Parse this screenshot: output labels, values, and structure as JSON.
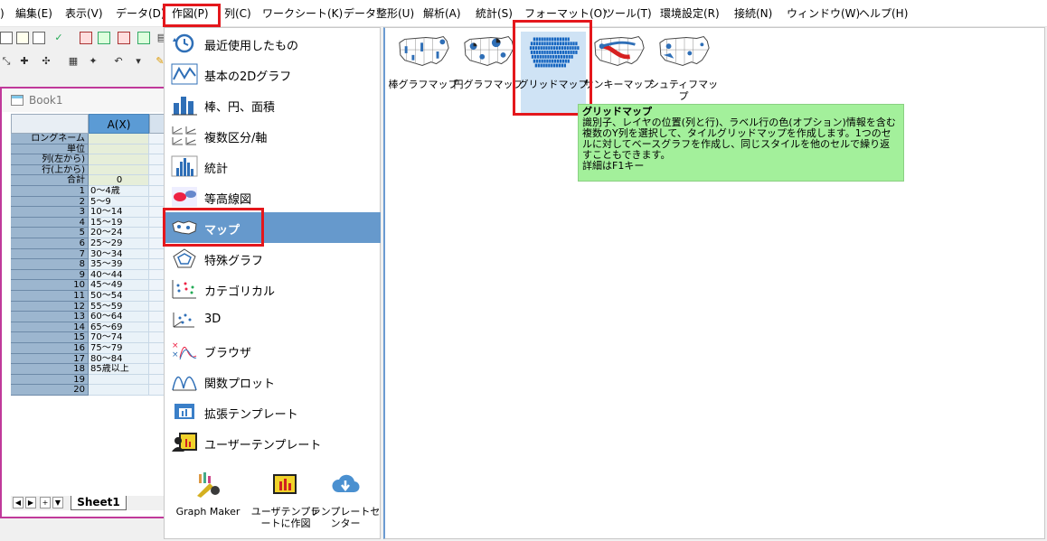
{
  "menu": {
    "edit": "編集(E)",
    "view": "表示(V)",
    "data": "データ(D)",
    "plot": "作図(P)",
    "column": "列(C)",
    "worksheet": "ワークシート(K)",
    "data_shape": "データ整形(U)",
    "analysis": "解析(A)",
    "statistics": "統計(S)",
    "format": "フォーマット(O)",
    "tools": "ツール(T)",
    "preferences": "環境設定(R)",
    "connect": "接続(N)",
    "window": "ウィンドウ(W)",
    "help": "ヘルプ(H)"
  },
  "workbook": {
    "title": "Book1",
    "column_a": "A(X)",
    "meta_rows": [
      "ロングネーム",
      "単位",
      "列(左から)",
      "行(上から)",
      "合計"
    ],
    "sum_value": "0",
    "rows": [
      {
        "n": "1",
        "v": "0〜4歳"
      },
      {
        "n": "2",
        "v": "5〜9"
      },
      {
        "n": "3",
        "v": "10〜14"
      },
      {
        "n": "4",
        "v": "15〜19"
      },
      {
        "n": "5",
        "v": "20〜24"
      },
      {
        "n": "6",
        "v": "25〜29"
      },
      {
        "n": "7",
        "v": "30〜34"
      },
      {
        "n": "8",
        "v": "35〜39"
      },
      {
        "n": "9",
        "v": "40〜44"
      },
      {
        "n": "10",
        "v": "45〜49"
      },
      {
        "n": "11",
        "v": "50〜54"
      },
      {
        "n": "12",
        "v": "55〜59"
      },
      {
        "n": "13",
        "v": "60〜64"
      },
      {
        "n": "14",
        "v": "65〜69"
      },
      {
        "n": "15",
        "v": "70〜74"
      },
      {
        "n": "16",
        "v": "75〜79"
      },
      {
        "n": "17",
        "v": "80〜84"
      },
      {
        "n": "18",
        "v": "85歳以上"
      },
      {
        "n": "19",
        "v": ""
      },
      {
        "n": "20",
        "v": ""
      }
    ],
    "sheet_tab": "Sheet1"
  },
  "dropdown": {
    "items": [
      {
        "label": "最近使用したもの",
        "icon": "clock-icon"
      },
      {
        "label": "基本の2Dグラフ",
        "icon": "line-graph-icon"
      },
      {
        "label": "棒、円、面積",
        "icon": "bar-chart-icon"
      },
      {
        "label": "複数区分/軸",
        "icon": "multi-panel-icon"
      },
      {
        "label": "統計",
        "icon": "histogram-icon"
      },
      {
        "label": "等高線図",
        "icon": "contour-icon"
      },
      {
        "label": "マップ",
        "icon": "map-icon"
      },
      {
        "label": "特殊グラフ",
        "icon": "radar-icon"
      },
      {
        "label": "カテゴリカル",
        "icon": "categorical-icon"
      },
      {
        "label": "3D",
        "icon": "3d-scatter-icon"
      },
      {
        "label": "ブラウザ",
        "icon": "browser-icon"
      },
      {
        "label": "関数プロット",
        "icon": "function-plot-icon"
      },
      {
        "label": "拡張テンプレート",
        "icon": "extended-template-icon"
      },
      {
        "label": "ユーザーテンプレート",
        "icon": "user-template-icon"
      }
    ],
    "bottom": [
      {
        "label": "Graph Maker",
        "icon": "graph-maker-icon"
      },
      {
        "label": "ユーザテンプレートに作図",
        "icon": "plot-to-template-icon"
      },
      {
        "label": "テンプレートセンター",
        "icon": "cloud-download-icon"
      }
    ]
  },
  "maps": [
    {
      "label": "棒グラフマップ"
    },
    {
      "label": "円グラフマップ"
    },
    {
      "label": "グリッドマップ"
    },
    {
      "label": "サンキーマップ"
    },
    {
      "label": "シュティフマップ"
    }
  ],
  "tooltip": {
    "title": "グリッドマップ",
    "body": "識別子、レイヤの位置(列と行)、ラベル行の色(オプション)情報を含む複数のY列を選択して、タイルグリッドマップを作成します。1つのセルに対してベースグラフを作成し、同じスタイルを他のセルで繰り返すこともできます。",
    "hint": "詳細はF1キー"
  },
  "colors": {
    "accent": "#6699cc",
    "highlight": "#e4171c",
    "tooltip": "#a3f09b"
  }
}
